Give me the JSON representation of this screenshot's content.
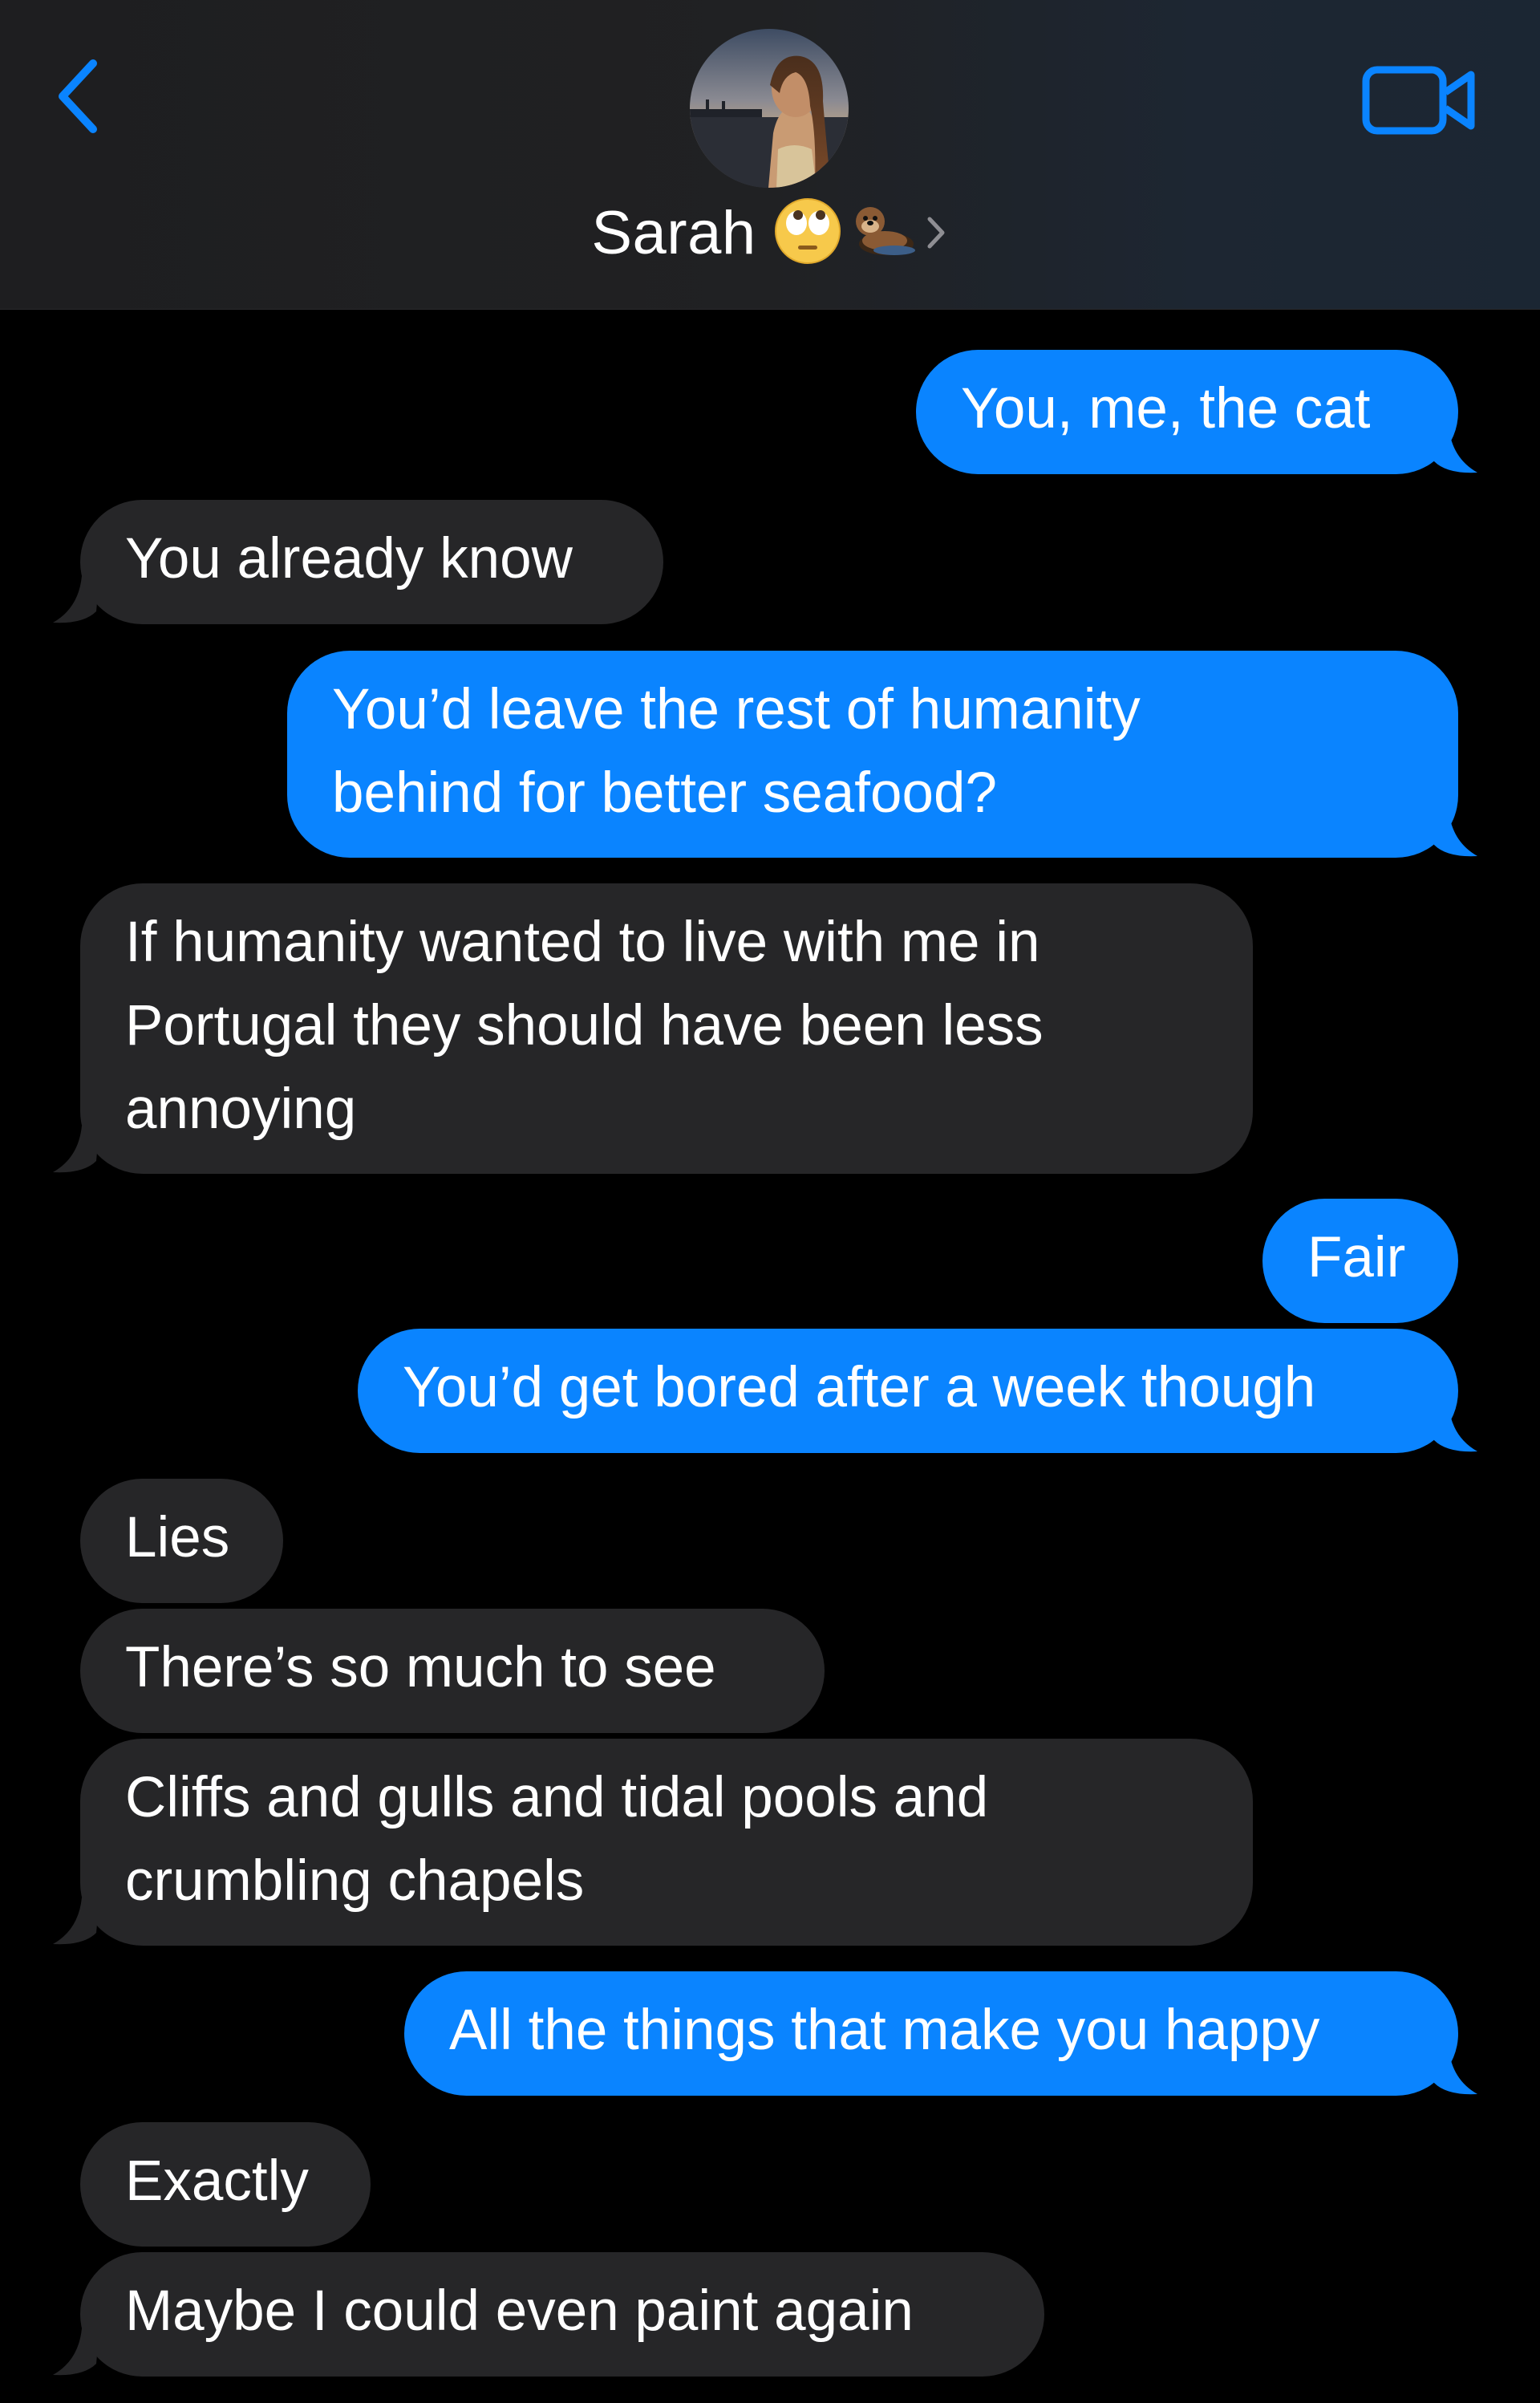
{
  "header": {
    "contact_name": "Sarah",
    "contact_emojis": [
      "face-with-rolling-eyes",
      "otter"
    ],
    "back_icon": "chevron-left-icon",
    "video_icon": "video-camera-icon",
    "disclosure_icon": "chevron-right-icon"
  },
  "colors": {
    "sent_bubble": "#0a84ff",
    "received_bubble": "#262628",
    "accent": "#0a84ff",
    "background": "#000000"
  },
  "messages": [
    {
      "direction": "sent",
      "lines": [
        "You, me, the cat"
      ]
    },
    {
      "direction": "received",
      "lines": [
        "You already know"
      ]
    },
    {
      "direction": "sent",
      "lines": [
        "You’d leave the rest of humanity",
        "behind for better seafood?"
      ]
    },
    {
      "direction": "received",
      "lines": [
        "If humanity wanted to live with me in",
        "Portugal they should have been less",
        "annoying"
      ]
    },
    {
      "direction": "sent",
      "lines": [
        "Fair"
      ]
    },
    {
      "direction": "sent",
      "lines": [
        "You’d get bored after a week though"
      ]
    },
    {
      "direction": "received",
      "lines": [
        "Lies"
      ]
    },
    {
      "direction": "received",
      "lines": [
        "There’s so much to see"
      ]
    },
    {
      "direction": "received",
      "lines": [
        "Cliffs and gulls and tidal pools and",
        "crumbling chapels"
      ]
    },
    {
      "direction": "sent",
      "lines": [
        "All the things that make you happy"
      ]
    },
    {
      "direction": "received",
      "lines": [
        "Exactly"
      ]
    },
    {
      "direction": "received",
      "lines": [
        "Maybe I could even paint again"
      ]
    }
  ]
}
